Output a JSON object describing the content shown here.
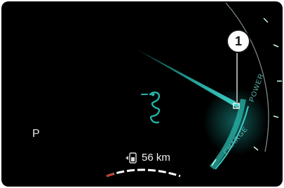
{
  "display": {
    "gear_label": "P",
    "range_value": "56 km",
    "callout_number": "1",
    "power_label": "POWER",
    "charge_label": "CHARGE",
    "accent_color": "#1fa8a0",
    "icons": [
      "alfa-romeo-serpent-icon",
      "battery-range-icon"
    ]
  }
}
